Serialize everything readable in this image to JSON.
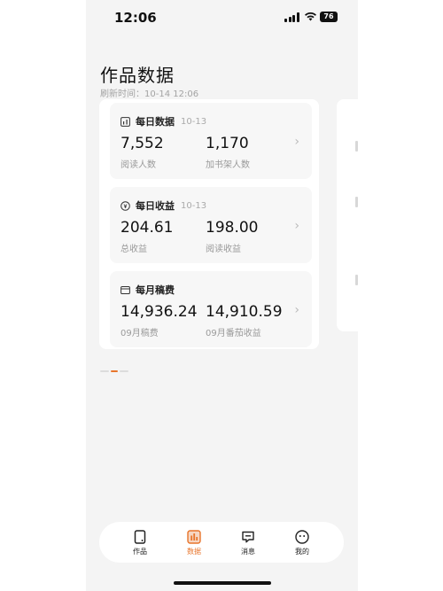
{
  "status_bar": {
    "time": "12:06",
    "battery": "76"
  },
  "header": {
    "title": "作品数据",
    "refresh": "刷新时间：10-14 12:06"
  },
  "daily_data": {
    "title": "每日数据",
    "date": "10-13",
    "value1": "7,552",
    "label1": "阅读人数",
    "value2": "1,170",
    "label2": "加书架人数"
  },
  "daily_income": {
    "title": "每日收益",
    "date": "10-13",
    "value1": "204.61",
    "label1": "总收益",
    "value2": "198.00",
    "label2": "阅读收益"
  },
  "monthly_fee": {
    "title": "每月稿费",
    "value1": "14,936.24",
    "label1": "09月稿费",
    "value2": "14,910.59",
    "label2": "09月番茄收益"
  },
  "tabs": [
    {
      "label": "作品",
      "icon": "book-icon"
    },
    {
      "label": "数据",
      "icon": "chart-icon"
    },
    {
      "label": "消息",
      "icon": "message-icon"
    },
    {
      "label": "我的",
      "icon": "profile-icon"
    }
  ],
  "colors": {
    "accent": "#e8752c",
    "background": "#f4f4f4"
  }
}
